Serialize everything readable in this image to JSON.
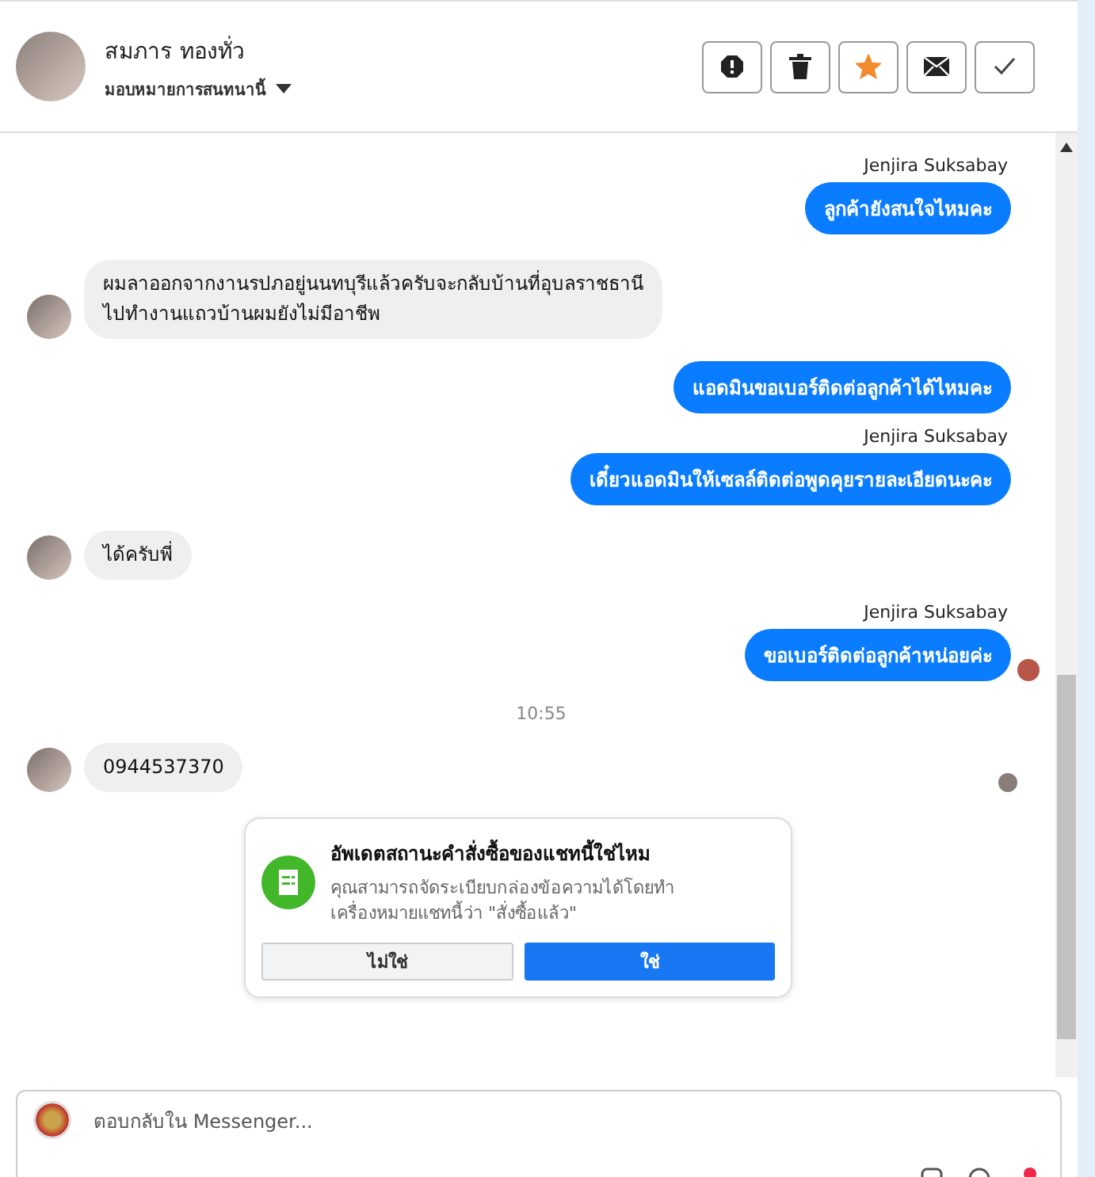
{
  "header": {
    "name": "สมภาร ทองทั่ว",
    "assign": "มอบหมายการสนทนานี้",
    "starred": true,
    "actions": [
      {
        "kind": "alert"
      },
      {
        "kind": "trash"
      },
      {
        "kind": "star"
      },
      {
        "kind": "mail"
      },
      {
        "kind": "check"
      }
    ]
  },
  "messages": [
    {
      "kind": "outgoing",
      "sender": "Jenjira Suksabay",
      "text": "ลูกค้ายังสนใจไหมคะ",
      "seen": false
    },
    {
      "kind": "incoming",
      "text": "ผมลาออกจากงานรปภอยู่นนทบุรีแล้วครับจะกลับบ้านที่อุบลราชธานี\nไปทำงานแถวบ้านผมยังไม่มีอาชีพ"
    },
    {
      "kind": "outgoing",
      "text": "แอดมินขอเบอร์ติดต่อลูกค้าได้ไหมคะ",
      "seen": false
    },
    {
      "kind": "outgoing",
      "sender": "Jenjira Suksabay",
      "text": "เดี๋ยวแอดมินให้เซลล์ติดต่อพูดคุยรายละเอียดนะคะ",
      "seen": false
    },
    {
      "kind": "incoming",
      "text": "ได้ครับพี่"
    },
    {
      "kind": "outgoing",
      "sender": "Jenjira Suksabay",
      "text": "ขอเบอร์ติดต่อลูกค้าหน่อยค่ะ",
      "seen": true
    },
    {
      "kind": "time",
      "text": "10:55"
    },
    {
      "kind": "incoming",
      "text": "0944537370",
      "seen": true
    }
  ],
  "prompt": {
    "title": "อัพเดตสถานะคำสั่งซื้อของแชทนี้ใช่ไหม",
    "body": "คุณสามารถจัดระเบียบกล่องข้อความได้โดยทำเครื่องหมายแชทนี้ว่า \"สั่งซื้อแล้ว\"",
    "buttons": [
      {
        "label": "ไม่ใช่",
        "kind": "secondary"
      },
      {
        "label": "ใช่",
        "kind": "primary"
      }
    ]
  },
  "composer": {
    "placeholder": "ตอบกลับใน Messenger..."
  }
}
